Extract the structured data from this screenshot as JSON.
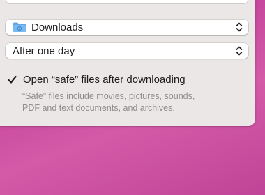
{
  "download_location": {
    "value": "Downloads",
    "icon": "folder-icon",
    "chevron": "chevron-updown-icon"
  },
  "remove_items": {
    "value": "After one day",
    "chevron": "chevron-updown-icon"
  },
  "open_safe": {
    "checked": true,
    "label": "Open “safe” files after downloading",
    "description_line1": "“Safe” files include movies, pictures, sounds,",
    "description_line2": "PDF and text documents, and archives."
  },
  "colors": {
    "panel": "#ebe7e6",
    "desktop": "#c7489e",
    "folder": "#62a6e8"
  }
}
